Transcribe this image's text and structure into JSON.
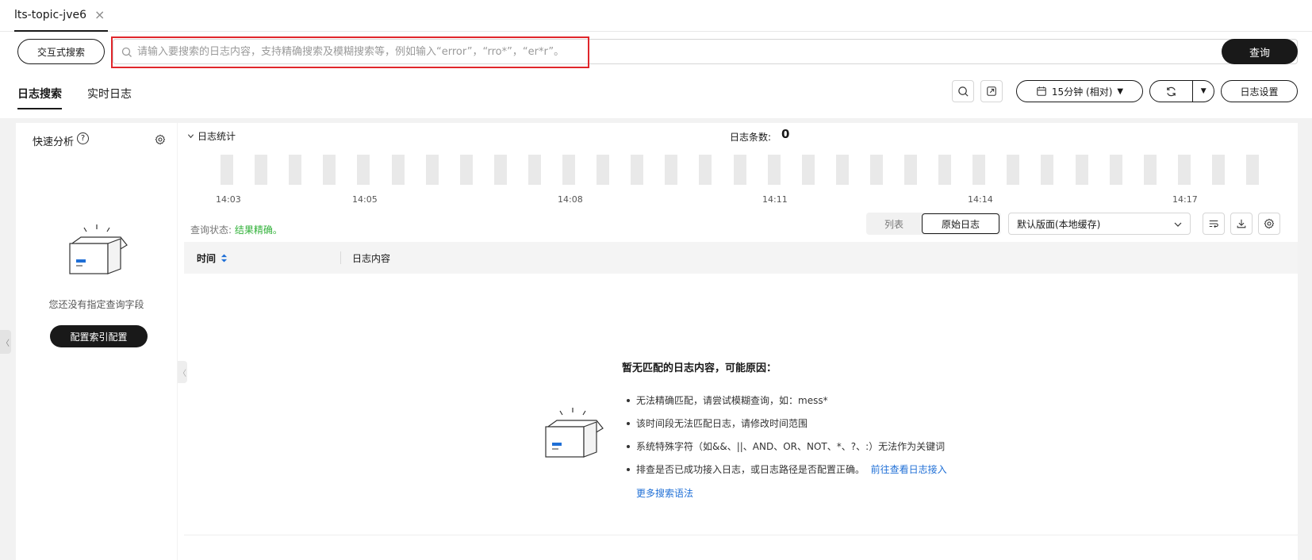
{
  "tab": {
    "title": "lts-topic-jve6",
    "close": "×"
  },
  "search": {
    "mode_label": "交互式搜索",
    "placeholder": "请输入要搜索的日志内容，支持精确搜索及模糊搜索等，例如输入“error”，“rro*”，“er*r”。",
    "value": "",
    "query_label": "查询"
  },
  "subtabs": [
    {
      "label": "日志搜索",
      "active": true
    },
    {
      "label": "实时日志",
      "active": false
    }
  ],
  "toolbar": {
    "time_range": "15分钟 (相对)",
    "time_caret": "▼",
    "refresh_caret": "▼",
    "log_settings": "日志设置"
  },
  "quick_analysis": {
    "title": "快速分析",
    "help": "?",
    "empty_text": "您还没有指定查询字段",
    "config_button": "配置索引配置"
  },
  "stats": {
    "toggle_label": "日志统计",
    "count_label": "日志条数:",
    "count_value": "0",
    "ticks": [
      "14:03",
      "14:05",
      "14:08",
      "14:11",
      "14:14",
      "14:17"
    ]
  },
  "status": {
    "label": "查询状态:",
    "value": "结果精确。"
  },
  "view": {
    "list": "列表",
    "raw": "原始日志",
    "layout": "默认版面(本地缓存)"
  },
  "table": {
    "col_time": "时间",
    "col_content": "日志内容"
  },
  "empty": {
    "title": "暂无匹配的日志内容，可能原因：",
    "reasons": [
      "无法精确匹配，请尝试模糊查询，如：mess*",
      "该时间段无法匹配日志，请修改时间范围",
      "系统特殊字符（如&&、||、AND、OR、NOT、*、?、:）无法作为关键词",
      "排查是否已成功接入日志，或日志路径是否配置正确。"
    ],
    "reason_link": "前往查看日志接入",
    "more_link": "更多搜索语法"
  },
  "colors": {
    "accent": "#191919",
    "link": "#1f6fd6",
    "success": "#33b23b",
    "highlight": "#e0262b"
  }
}
